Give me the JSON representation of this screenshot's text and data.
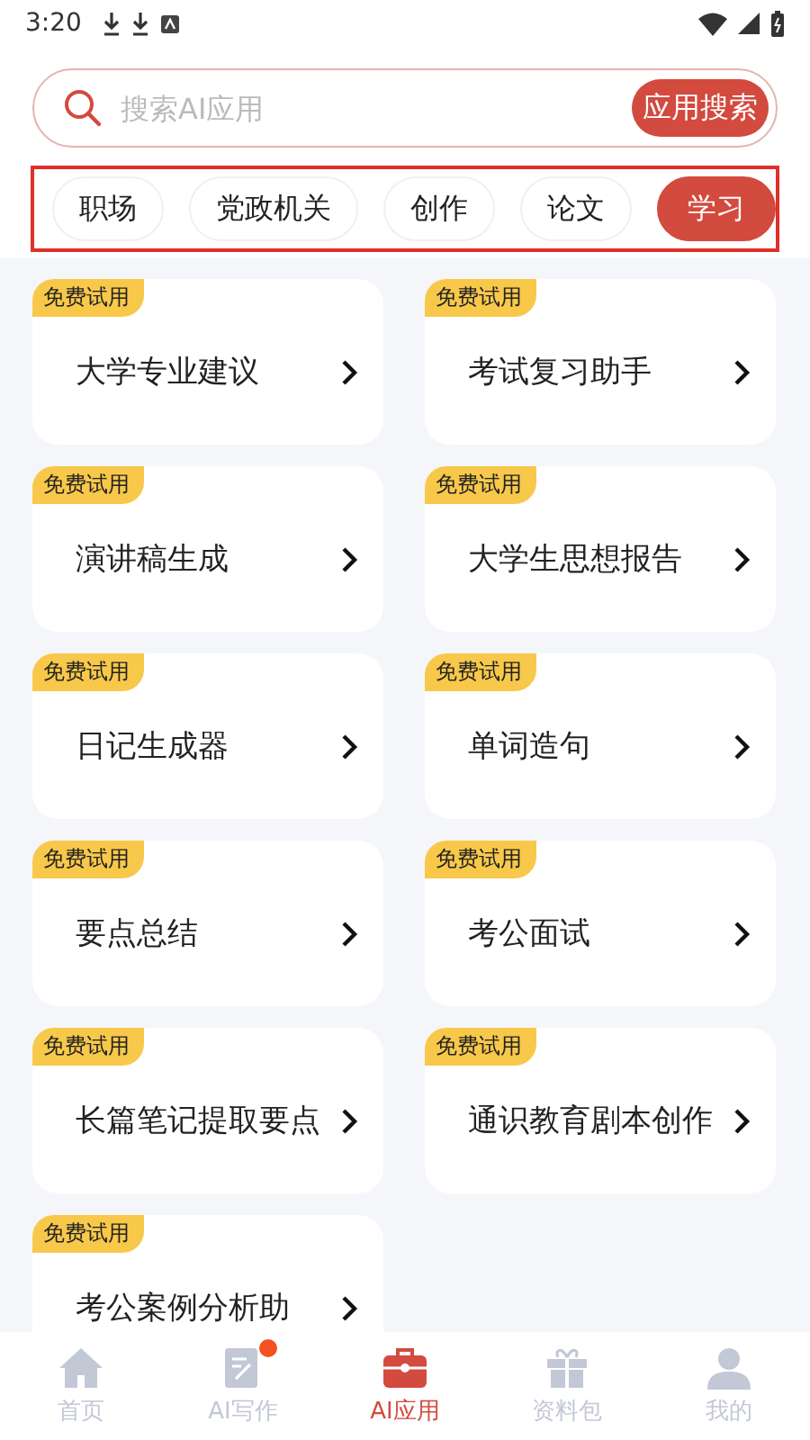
{
  "status_bar": {
    "time": "3:20"
  },
  "search": {
    "placeholder": "搜索AI应用",
    "button": "应用搜索"
  },
  "categories": [
    {
      "label": "职场",
      "selected": false
    },
    {
      "label": "党政机关",
      "selected": false
    },
    {
      "label": "创作",
      "selected": false
    },
    {
      "label": "论文",
      "selected": false
    },
    {
      "label": "学习",
      "selected": true
    }
  ],
  "apps": [
    {
      "badge": "免费试用",
      "title": "大学专业建议"
    },
    {
      "badge": "免费试用",
      "title": "考试复习助手"
    },
    {
      "badge": "免费试用",
      "title": "演讲稿生成"
    },
    {
      "badge": "免费试用",
      "title": "大学生思想报告"
    },
    {
      "badge": "免费试用",
      "title": "日记生成器"
    },
    {
      "badge": "免费试用",
      "title": "单词造句"
    },
    {
      "badge": "免费试用",
      "title": "要点总结"
    },
    {
      "badge": "免费试用",
      "title": "考公面试"
    },
    {
      "badge": "免费试用",
      "title": "长篇笔记提取要点"
    },
    {
      "badge": "免费试用",
      "title": "通识教育剧本创作"
    },
    {
      "badge": "免费试用",
      "title": "考公案例分析助"
    }
  ],
  "bottom_nav": [
    {
      "kind": "home",
      "label": "首页",
      "selected": false,
      "dot": false
    },
    {
      "kind": "write",
      "label": "AI写作",
      "selected": false,
      "dot": true
    },
    {
      "kind": "apps",
      "label": "AI应用",
      "selected": true,
      "dot": false
    },
    {
      "kind": "gift",
      "label": "资料包",
      "selected": false,
      "dot": false
    },
    {
      "kind": "user",
      "label": "我的",
      "selected": false,
      "dot": false
    }
  ]
}
